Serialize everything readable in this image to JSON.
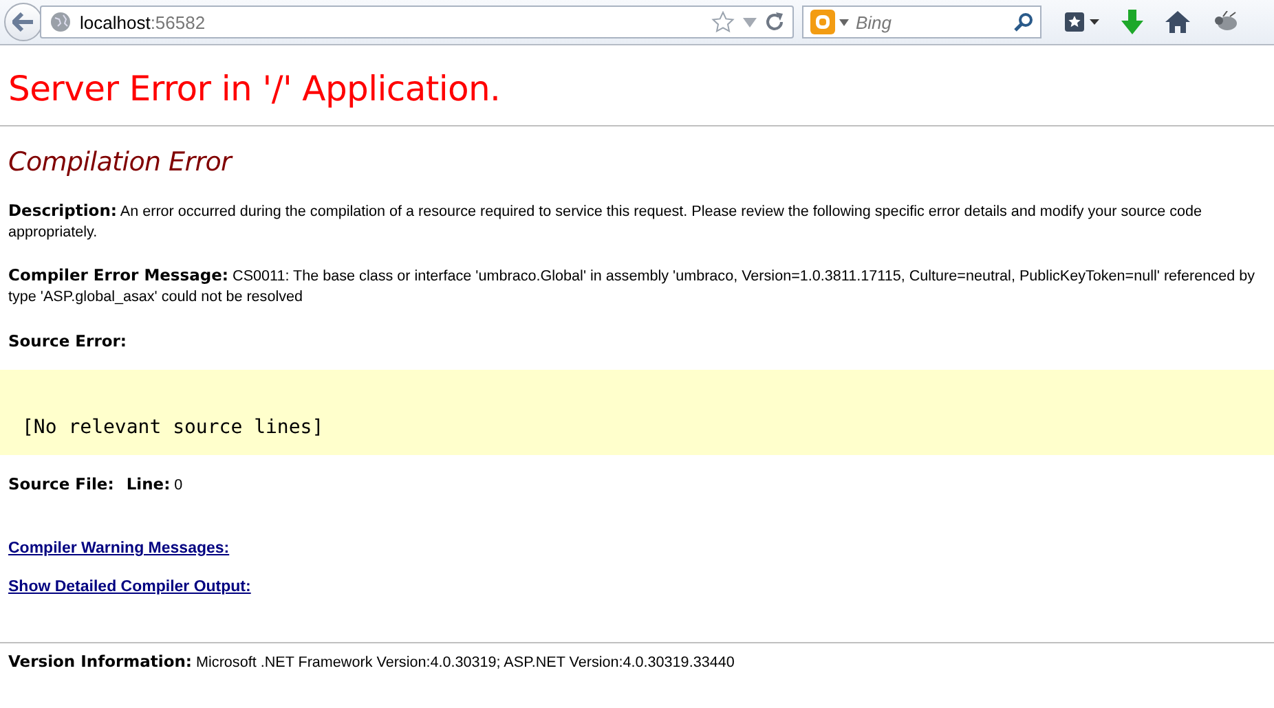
{
  "browser": {
    "address": {
      "host": "localhost",
      "port": ":56582"
    },
    "search": {
      "placeholder": "Bing"
    }
  },
  "page": {
    "title": "Server Error in '/' Application.",
    "subtitle": "Compilation Error",
    "description": "**Description:** An error occurred during the compilation of a resource required to service this request. Please review the following specific error details and modify your source code appropriately.",
    "compiler_message": "**Compiler Error Message:** CS0011: The base class or interface 'umbraco.Global' in assembly 'umbraco, Version=1.0.3811.17115, Culture=neutral, PublicKeyToken=null' referenced by type 'ASP.global_asax' could not be resolved",
    "source_error": {
      "label": "Source Error:",
      "code": "[No relevant source lines]"
    },
    "source_file": "**Source File:**   **Line:** 0",
    "links": [
      "Compiler Warning Messages:",
      "Show Detailed Compiler Output:"
    ],
    "version": "**Version Information:** Microsoft .NET Framework Version:4.0.30319; ASP.NET Version:4.0.30319.33440"
  }
}
